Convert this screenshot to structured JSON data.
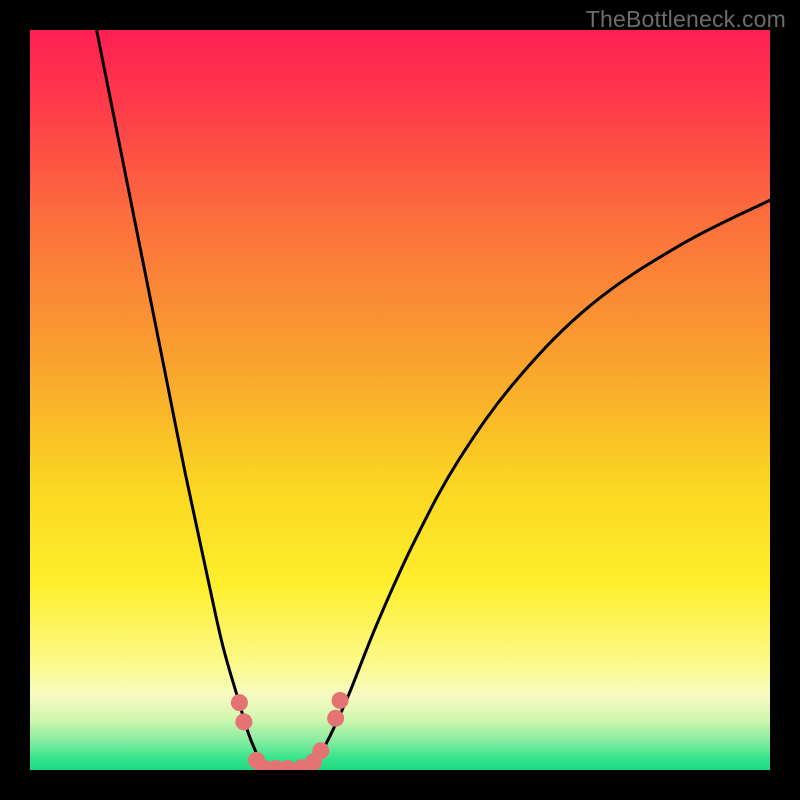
{
  "watermark": "TheBottleneck.com",
  "chart_data": {
    "type": "line",
    "title": "",
    "xlabel": "",
    "ylabel": "",
    "xlim": [
      0,
      100
    ],
    "ylim": [
      0,
      100
    ],
    "grid": false,
    "series": [
      {
        "name": "left-curve",
        "x": [
          9,
          12,
          15,
          18,
          21,
          24,
          26,
          28,
          29.5,
          30.5,
          31,
          31.5
        ],
        "y": [
          100,
          85,
          70,
          55,
          40,
          26,
          17,
          10,
          5,
          2.5,
          1.2,
          0
        ]
      },
      {
        "name": "right-curve",
        "x": [
          38,
          39,
          40.5,
          43,
          47,
          52,
          58,
          66,
          76,
          88,
          100
        ],
        "y": [
          0,
          1.8,
          4.5,
          10,
          20,
          31,
          42,
          53,
          63,
          71,
          77
        ]
      }
    ],
    "markers": [
      {
        "name": "dot-left-upper",
        "x": 28.3,
        "y": 9.1
      },
      {
        "name": "dot-left-upper2",
        "x": 28.9,
        "y": 6.5
      },
      {
        "name": "dot-left-lower",
        "x": 30.6,
        "y": 1.3
      },
      {
        "name": "dot-valley-1",
        "x": 31.5,
        "y": 0.3
      },
      {
        "name": "dot-valley-2",
        "x": 33.2,
        "y": 0.2
      },
      {
        "name": "dot-valley-3",
        "x": 34.8,
        "y": 0.2
      },
      {
        "name": "dot-valley-4",
        "x": 36.7,
        "y": 0.3
      },
      {
        "name": "dot-right-lower",
        "x": 38.3,
        "y": 1.1
      },
      {
        "name": "dot-right-mid",
        "x": 39.3,
        "y": 2.6
      },
      {
        "name": "dot-right-upper",
        "x": 41.3,
        "y": 7.0
      },
      {
        "name": "dot-right-top",
        "x": 41.9,
        "y": 9.4
      }
    ],
    "gradient": {
      "stops": [
        {
          "offset": 0.0,
          "color": "#ff1f53"
        },
        {
          "offset": 0.1,
          "color": "#ff3a4a"
        },
        {
          "offset": 0.25,
          "color": "#fc6d3d"
        },
        {
          "offset": 0.45,
          "color": "#f9a32e"
        },
        {
          "offset": 0.62,
          "color": "#fbd722"
        },
        {
          "offset": 0.75,
          "color": "#feef2d"
        },
        {
          "offset": 0.86,
          "color": "#fcfa8e"
        },
        {
          "offset": 0.9,
          "color": "#f6fbc3"
        },
        {
          "offset": 0.93,
          "color": "#d4f6b0"
        },
        {
          "offset": 0.96,
          "color": "#88eda0"
        },
        {
          "offset": 0.985,
          "color": "#34e48d"
        },
        {
          "offset": 1.0,
          "color": "#1fd983"
        }
      ]
    },
    "marker_color": "#e57373",
    "curve_color": "#000000"
  }
}
